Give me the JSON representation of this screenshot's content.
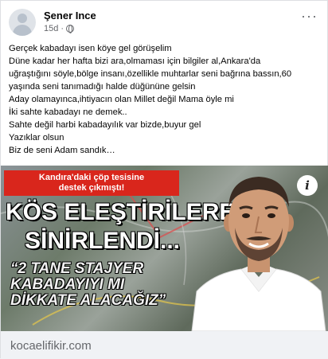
{
  "post": {
    "author": "Şener Ince",
    "time": "15d ·",
    "more_label": "···",
    "lines": [
      "Gerçek kabadayı isen köye gel görüşelim",
      "Düne kadar her hafta bizi ara,olmaması için bilgiler al,Ankara'da",
      "uğraştığını söyle,bölge insanı,özellikle muhtarlar seni bağrına bassın,60",
      "yaşında seni tanımadığı halde düğününe gelsin",
      "Aday olamayınca,ihtiyacın olan Millet değil Mama öyle mi",
      "İki sahte kabadayı ne demek..",
      "Sahte değil harbi kabadayılık var bizde,buyur gel",
      "Yazıklar olsun",
      "Biz de seni Adam sandık…"
    ]
  },
  "media": {
    "banner_line1": "Kandıra'daki çöp tesisine",
    "banner_line2": "destek çıkmıştı!",
    "headline_line1": "KÖS ELEŞTİRİLERE",
    "headline_line2": "SİNİRLENDİ...",
    "quote_line1": "“2 TANE STAJYER",
    "quote_line2": "KABADAYIYI MI",
    "quote_line3": "DİKKATE ALACAĞIZ”",
    "info_label": "i"
  },
  "link": {
    "domain": "kocaelifikir.com"
  },
  "icons": {
    "avatar": "default-avatar-icon",
    "privacy": "globe-icon",
    "more": "more-options-icon",
    "info": "info-icon"
  },
  "colors": {
    "banner_red": "#d9261c",
    "meta_gray": "#65676b",
    "footer_bg": "#f0f2f5"
  }
}
